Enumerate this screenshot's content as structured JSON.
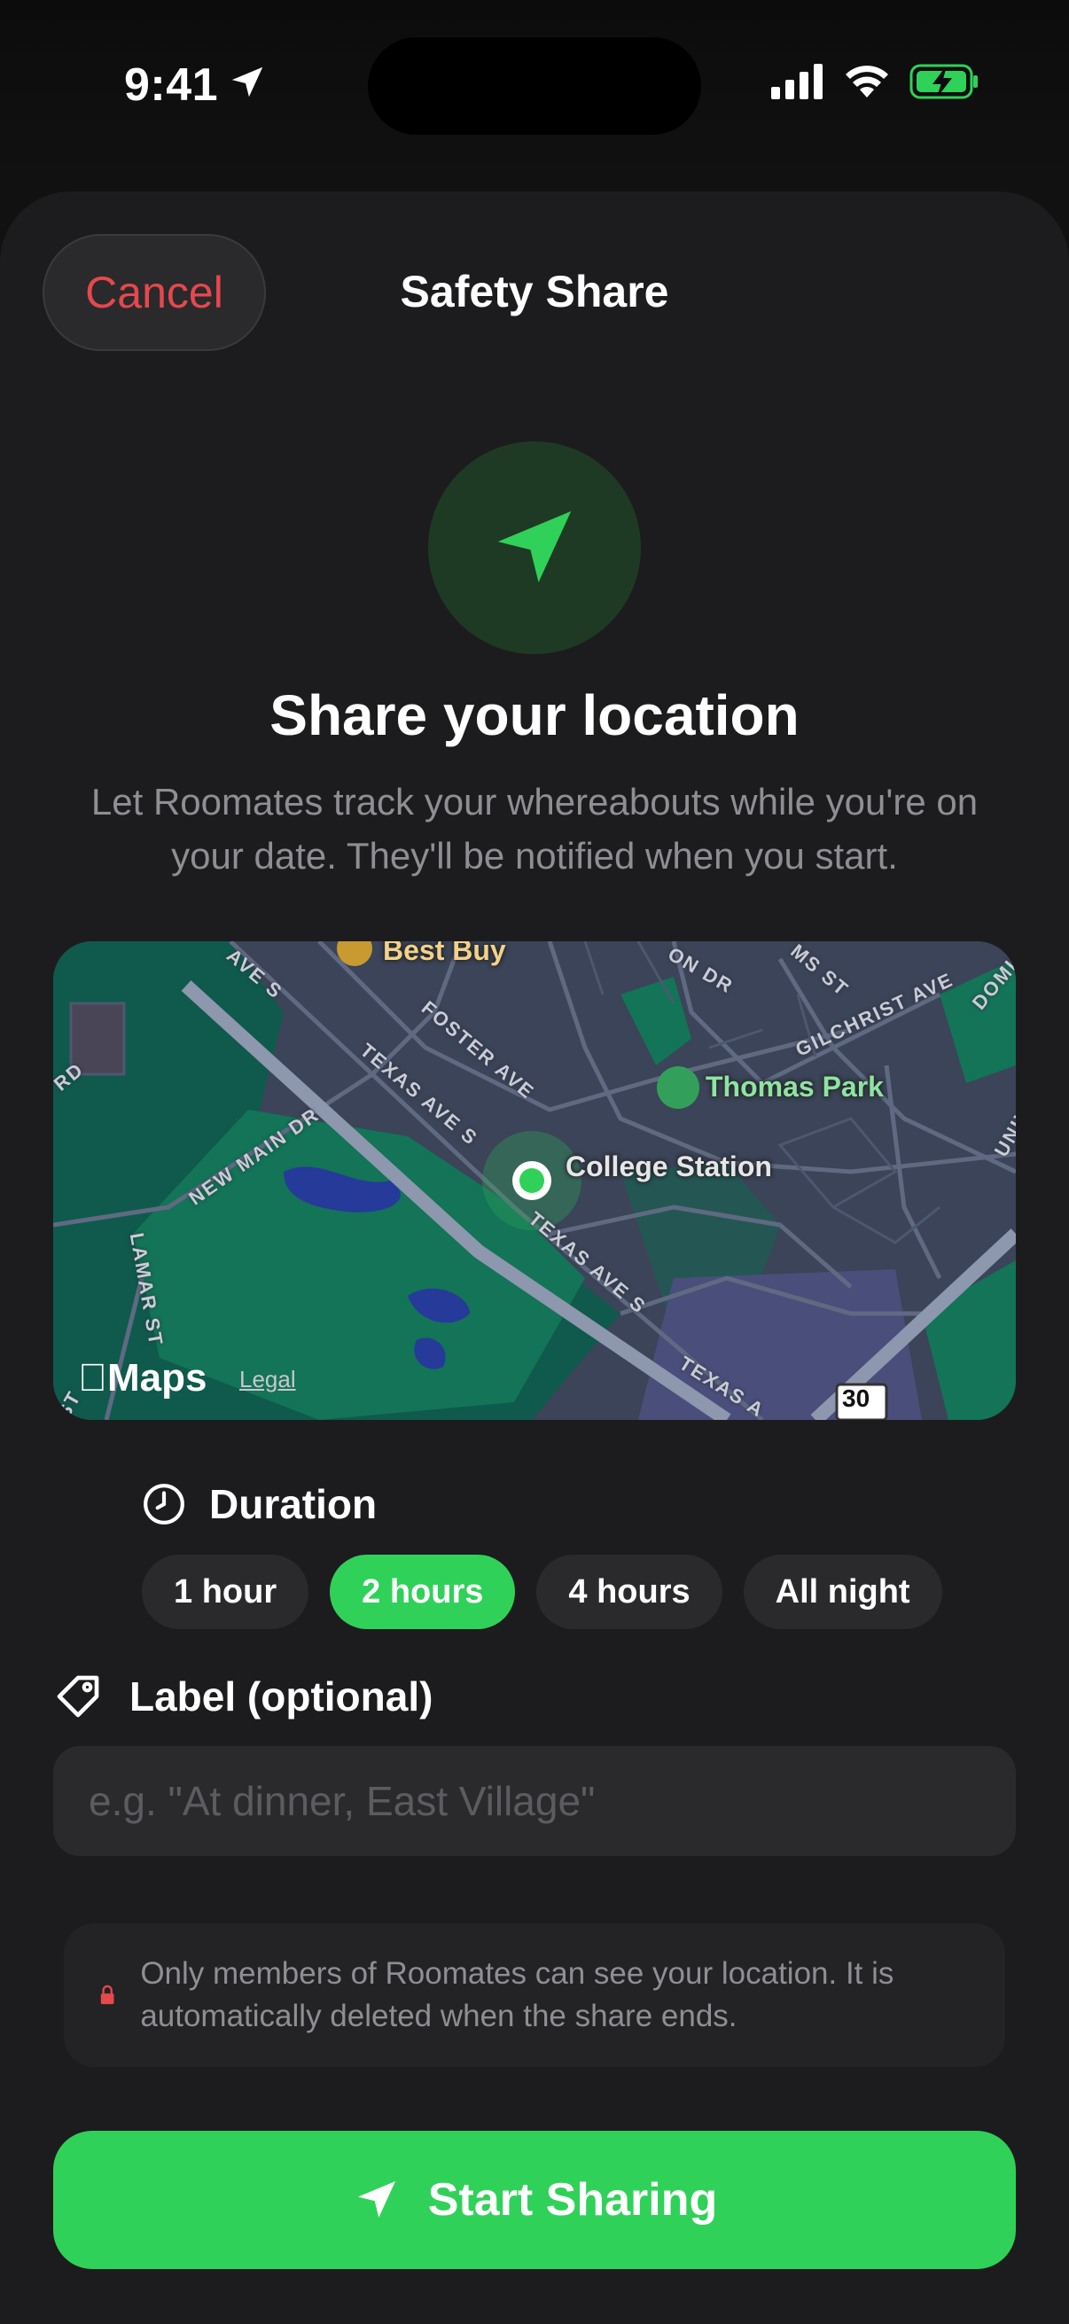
{
  "status": {
    "time": "9:41"
  },
  "header": {
    "cancel_label": "Cancel",
    "title": "Safety Share"
  },
  "hero": {
    "title": "Share your location",
    "description": "Let Roomates track your whereabouts while you're on your date. They'll be notified when you start."
  },
  "map": {
    "poi_top": "Best Buy",
    "poi_park": "Thomas Park",
    "current_place": "College Station",
    "streets": [
      "AVE S",
      "FOSTER AVE",
      "ON DR",
      "MS ST",
      "GILCHRIST AVE",
      "DOMI",
      "RD",
      "NEW MAIN DR",
      "TEXAS AVE S",
      "TEXAS AVE S",
      "TEXAS A",
      "UNIVERS",
      "LAMAR ST",
      "ST"
    ],
    "route_shield": "30",
    "brand": "Maps",
    "legal": "Legal"
  },
  "duration": {
    "label": "Duration",
    "options": [
      "1 hour",
      "2 hours",
      "4 hours",
      "All night"
    ],
    "selected": "2 hours"
  },
  "label_field": {
    "label": "Label (optional)",
    "placeholder": "e.g. \"At dinner, East Village\"",
    "value": ""
  },
  "privacy_note": "Only members of Roomates can see your location. It is automatically deleted when the share ends.",
  "start_button": "Start Sharing",
  "colors": {
    "accent": "#30d158",
    "cancel": "#e5484d",
    "lock": "#e5484d"
  }
}
